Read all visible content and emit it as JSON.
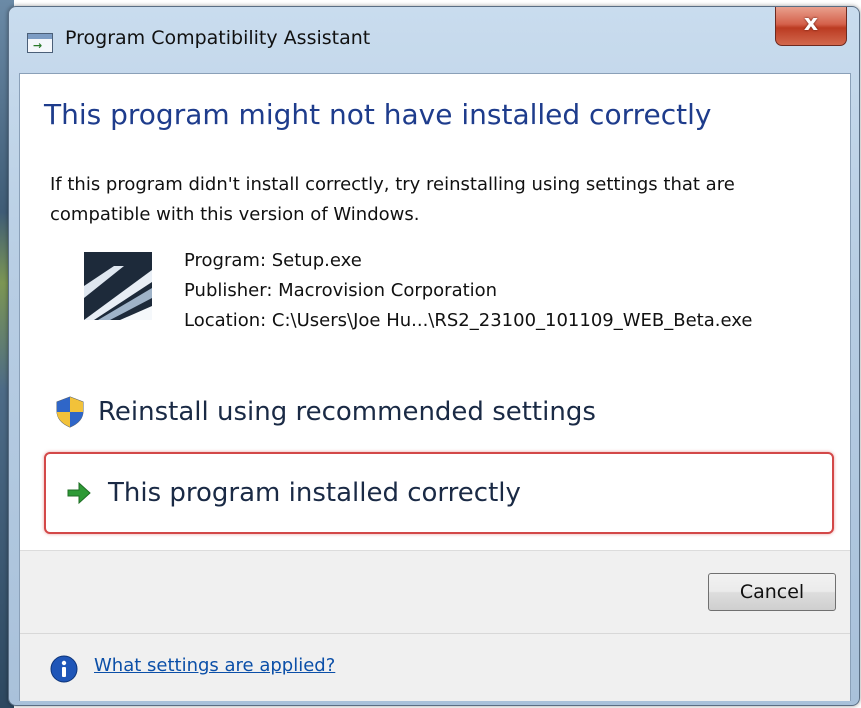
{
  "window": {
    "title": "Program Compatibility Assistant",
    "close_label": "x"
  },
  "content": {
    "heading": "This program might not have installed correctly",
    "description": "If this program didn't install correctly, try reinstalling using settings that are compatible with this version of Windows.",
    "program_icon": "setup-program-icon",
    "program_line": "Program: Setup.exe",
    "publisher_line": "Publisher: Macrovision Corporation",
    "location_line": "Location: C:\\Users\\Joe Hu...\\RS2_23100_101109_WEB_Beta.exe"
  },
  "options": {
    "reinstall": {
      "label": "Reinstall using recommended settings",
      "icon": "shield-icon"
    },
    "installed_correctly": {
      "label": "This program installed correctly",
      "icon": "green-arrow-icon"
    }
  },
  "footer": {
    "cancel_label": "Cancel",
    "help_link": "What settings are applied?",
    "help_icon": "info-icon"
  },
  "colors": {
    "heading": "#1e3c8c",
    "highlight_border": "#d34848",
    "link": "#0b4fa8",
    "close_button": "#c94a33"
  }
}
